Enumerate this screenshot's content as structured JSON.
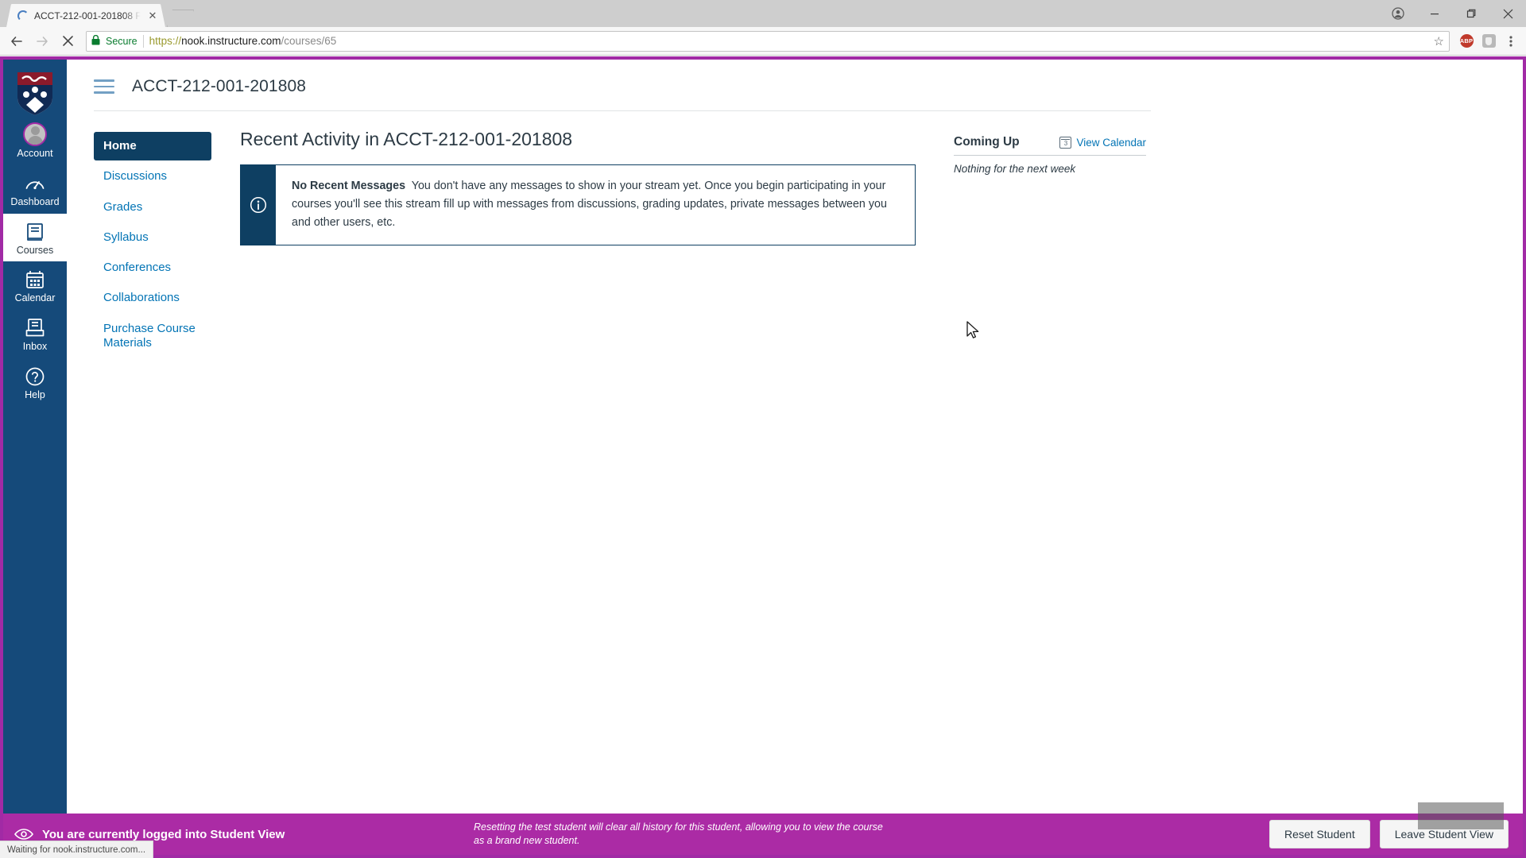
{
  "browser": {
    "tab": {
      "title": "ACCT-212-001-201808 F",
      "favicon": "loading-spinner-icon",
      "close_icon": "close-icon"
    },
    "new_tab_icon": "new-tab-icon",
    "window_controls": {
      "profile_icon": "profile-icon",
      "minimize": "minimize-icon",
      "maximize": "maximize-icon",
      "close": "close-icon"
    },
    "nav": {
      "back_icon": "back-arrow-icon",
      "forward_icon": "forward-arrow-icon",
      "stop_icon": "stop-loading-icon"
    },
    "omnibox": {
      "security_label": "Secure",
      "lock_icon": "lock-icon",
      "url_scheme": "https://",
      "url_host": "nook.instructure.com",
      "url_path": "/courses/65",
      "full_url": "https://nook.instructure.com/courses/65",
      "bookmark_icon": "star-icon"
    },
    "extensions": [
      {
        "name": "adblock-plus-extension",
        "label": "ABP"
      },
      {
        "name": "extension-two",
        "label": ""
      }
    ],
    "menu_icon": "kebab-menu-icon",
    "status_text": "Waiting for nook.instructure.com..."
  },
  "global_nav": {
    "logo_name": "university-shield-logo",
    "items": [
      {
        "label": "Account",
        "icon": "avatar-icon",
        "active": false
      },
      {
        "label": "Dashboard",
        "icon": "dashboard-gauge-icon",
        "active": false
      },
      {
        "label": "Courses",
        "icon": "courses-book-icon",
        "active": true
      },
      {
        "label": "Calendar",
        "icon": "calendar-icon",
        "active": false
      },
      {
        "label": "Inbox",
        "icon": "inbox-icon",
        "active": false
      },
      {
        "label": "Help",
        "icon": "help-question-icon",
        "active": false
      }
    ]
  },
  "course": {
    "menu_icon": "hamburger-menu-icon",
    "title": "ACCT-212-001-201808",
    "nav": [
      {
        "label": "Home",
        "active": true
      },
      {
        "label": "Discussions",
        "active": false
      },
      {
        "label": "Grades",
        "active": false
      },
      {
        "label": "Syllabus",
        "active": false
      },
      {
        "label": "Conferences",
        "active": false
      },
      {
        "label": "Collaborations",
        "active": false
      },
      {
        "label": "Purchase Course Materials",
        "active": false
      }
    ]
  },
  "stream": {
    "heading": "Recent Activity in ACCT-212-001-201808",
    "alert": {
      "icon": "info-circle-icon",
      "title": "No Recent Messages",
      "message": "You don't have any messages to show in your stream yet. Once you begin participating in your courses you'll see this stream fill up with messages from discussions, grading updates, private messages between you and other users, etc."
    }
  },
  "right_rail": {
    "title": "Coming Up",
    "view_calendar_label": "View Calendar",
    "calendar_icon": "calendar-icon",
    "calendar_icon_day": "3",
    "empty_text": "Nothing for the next week"
  },
  "student_view_bar": {
    "icon": "student-view-eye-icon",
    "message": "You are currently logged into Student View",
    "note": "Resetting the test student will clear all history for this student, allowing you to view the course as a brand new student.",
    "reset_label": "Reset Student",
    "leave_label": "Leave Student View"
  },
  "colors": {
    "accent_magenta": "#a12aa5",
    "brand_navy": "#154a7a",
    "nav_active": "#0e3f62",
    "link_blue": "#0374b5",
    "student_bar": "#ab2ba5"
  }
}
